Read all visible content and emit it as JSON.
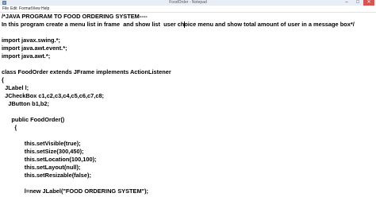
{
  "window": {
    "title": "FoodOrder - Notepad",
    "controls": {
      "minimize": "–",
      "maximize": "□",
      "close": "✕"
    }
  },
  "menu": {
    "items": [
      "File",
      "Edit",
      "Format",
      "View",
      "Help"
    ]
  },
  "editor": {
    "lines": [
      "/*JAVA PROGRAM TO FOOD ORDERING SYSTEM----",
      "In this program create a menu list in frame  and show list  user choice menu and show total amount of user in a message box*/",
      "",
      "import javax.swing.*;",
      "import java.awt.event.*;",
      "import java.awt.*;",
      "",
      "class FoodOrder extends JFrame implements ActionListener",
      "{",
      "  JLabel l;",
      "  JCheckBox c1,c2,c3,c4,c5,c6,c7,c8;",
      "    JButton b1,b2;",
      "",
      "      public FoodOrder()",
      "        {",
      "",
      "              this.setVisible(true);",
      "              this.setSize(300,450);",
      "              this.setLocation(100,100);",
      "              this.setLayout(null);",
      "              this.setResizable(false);",
      "",
      "              l=new JLabel(\"FOOD ORDERING SYSTEM\");"
    ]
  }
}
